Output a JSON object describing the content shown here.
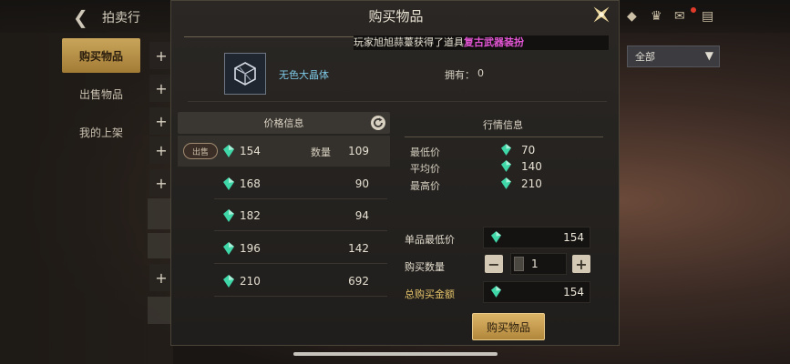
{
  "background": {
    "title": "拍卖行",
    "tabs": [
      {
        "label": "购买物品",
        "active": true
      },
      {
        "label": "出售物品",
        "active": false
      },
      {
        "label": "我的上架",
        "active": false
      }
    ],
    "filter_value": "全部"
  },
  "modal": {
    "title": "购买物品",
    "ticker": {
      "prefix": "玩家旭旭蒜薹获得了道具",
      "item": "复古武器装扮"
    },
    "item": {
      "name": "无色大晶体",
      "owned_label": "拥有：",
      "owned_value": "0"
    },
    "price_info": {
      "header": "价格信息",
      "sell_badge": "出售",
      "qty_label": "数量",
      "rows": [
        {
          "price": "154",
          "qty": "109"
        },
        {
          "price": "168",
          "qty": "90"
        },
        {
          "price": "182",
          "qty": "94"
        },
        {
          "price": "196",
          "qty": "142"
        },
        {
          "price": "210",
          "qty": "692"
        }
      ]
    },
    "market": {
      "header": "行情信息",
      "lowest_label": "最低价",
      "lowest_value": "70",
      "average_label": "平均价",
      "average_value": "140",
      "highest_label": "最高价",
      "highest_value": "210"
    },
    "purchase": {
      "unit_price_label": "单品最低价",
      "unit_price_value": "154",
      "quantity_label": "购买数量",
      "quantity_value": "1",
      "minus": "−",
      "plus": "+",
      "total_label": "总购买金额",
      "total_value": "154",
      "buy_button": "购买物品"
    }
  },
  "colors": {
    "gold": "#c9a55b",
    "pink": "#e455d6",
    "item_blue": "#7fc9e6",
    "gem": "#3fd6a8"
  }
}
